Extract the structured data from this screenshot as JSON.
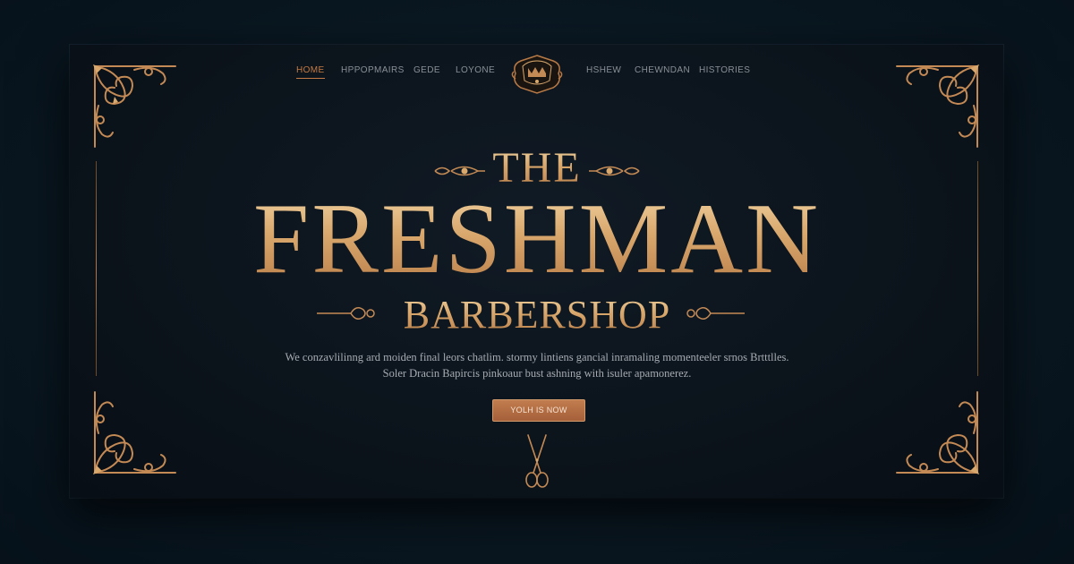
{
  "nav": {
    "items": [
      {
        "label": "HOME",
        "active": true
      },
      {
        "label": "HPPOPMAIRS",
        "active": false
      },
      {
        "label": "GEDE",
        "active": false
      },
      {
        "label": "LOYONE",
        "active": false
      },
      {
        "label": "HSHEW",
        "active": false
      },
      {
        "label": "CHEWNDAN",
        "active": false
      },
      {
        "label": "HISTORIES",
        "active": false
      }
    ]
  },
  "hero": {
    "pre_title": "THE",
    "title": "FRESHMAN",
    "subtitle": "BARBERSHOP",
    "tagline_line1": "We conzavlilinng ard moiden final leors chatlim. stormy lintiens gancial inramaling momenteeler srnos Brtttlles.",
    "tagline_line2": "Soler Dracin Bapircis pinkoaur bust ashning with isuler apamonerez.",
    "cta_label": "YOLH IS NOW"
  },
  "colors": {
    "accent_gold": "#d9a86d",
    "accent_copper": "#c17c4e",
    "background": "#0b131b"
  },
  "icons": [
    "crest-logo-icon",
    "scissors-icon",
    "flourish-corner-icon"
  ]
}
